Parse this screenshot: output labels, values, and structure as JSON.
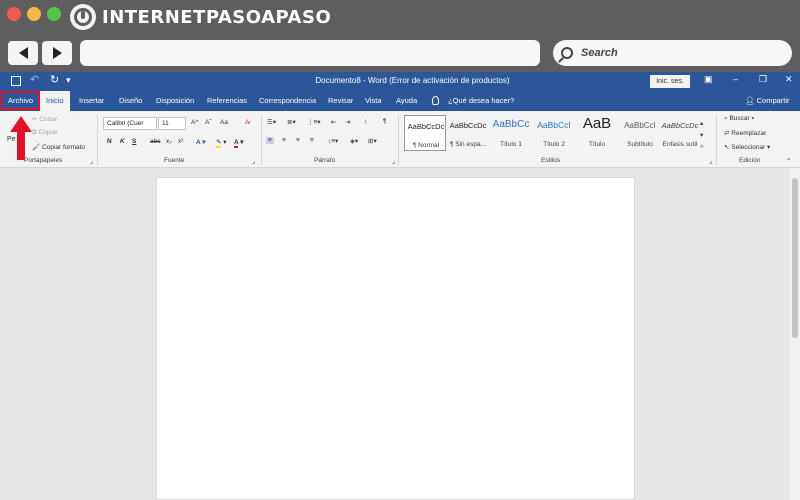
{
  "site": {
    "logo_text": "INTERNETPASOAPASO"
  },
  "browser": {
    "search_label": "Search"
  },
  "word": {
    "title": "Documento8  -  Word (Error de activación de productos)",
    "signin_label": "Inic. ses.",
    "tabs": [
      "Archivo",
      "Inicio",
      "Insertar",
      "Diseño",
      "Disposición",
      "Referencias",
      "Correspondencia",
      "Revisar",
      "Vista",
      "Ayuda"
    ],
    "tell_me": "¿Qué desea hacer?",
    "share": "Compartir"
  },
  "ribbon": {
    "clipboard": {
      "paste_partial": "Pe",
      "cut": "Cortar",
      "copy": "Copiar",
      "format_painter": "Copiar formato",
      "label": "Portapapeles"
    },
    "font": {
      "font_name": "Calibri (Cuer",
      "font_size": "11",
      "label": "Fuente",
      "bold": "N",
      "italic": "K",
      "underline": "S",
      "strike": "abc",
      "sub": "x₂",
      "sup": "x²",
      "grow": "A^",
      "shrink": "Aˇ",
      "case": "Aa"
    },
    "paragraph": {
      "label": "Párrafo",
      "pilcrow": "¶"
    },
    "styles": {
      "label": "Estilos",
      "items": [
        {
          "sample": "AaBbCcDc",
          "name": "¶ Normal"
        },
        {
          "sample": "AaBbCcDc",
          "name": "¶ Sin espa..."
        },
        {
          "sample": "AaBbCc",
          "name": "Título 1"
        },
        {
          "sample": "AaBbCcI",
          "name": "Título 2"
        },
        {
          "sample": "AaB",
          "name": "Título"
        },
        {
          "sample": "AaBbCcI",
          "name": "Subtítulo"
        },
        {
          "sample": "AaBbCcDc",
          "name": "Énfasis sutil"
        }
      ]
    },
    "editing": {
      "find": "Buscar",
      "replace": "Reemplazar",
      "select": "Seleccionar",
      "label": "Edición"
    }
  },
  "colors": {
    "word_blue": "#2b579a",
    "highlight_red": "#e0132a"
  }
}
